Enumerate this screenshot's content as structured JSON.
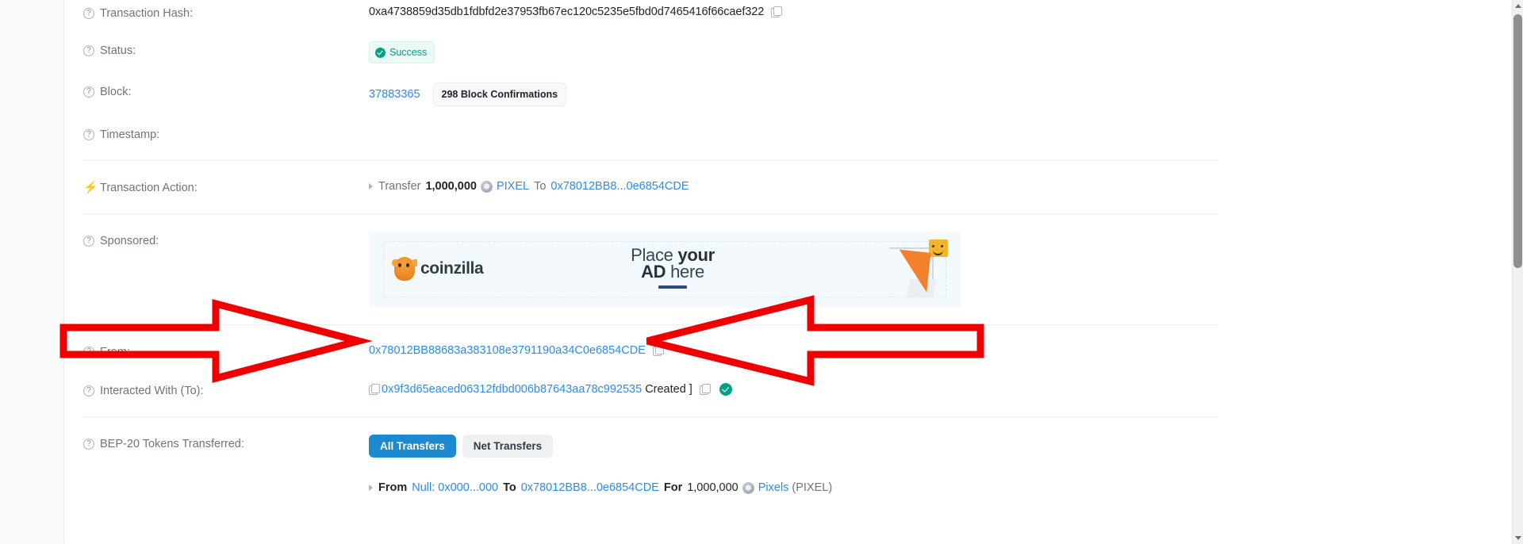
{
  "rows": {
    "tx_hash": {
      "label": "Transaction Hash:",
      "value": "0xa4738859d35db1fdbfd2e37953fb67ec120c5235e5fbd0d7465416f66caef322"
    },
    "status": {
      "label": "Status:",
      "value": "Success"
    },
    "block": {
      "label": "Block:",
      "number": "37883365",
      "confirmations": "298 Block Confirmations"
    },
    "timestamp": {
      "label": "Timestamp:",
      "value": ""
    },
    "action": {
      "label": "Transaction Action:",
      "verb": "Transfer",
      "amount": "1,000,000",
      "token": "PIXEL",
      "to_word": "To",
      "to_addr": "0x78012BB8...0e6854CDE"
    },
    "sponsored": {
      "label": "Sponsored:",
      "brand": "coinzilla",
      "line1_a": "Place ",
      "line1_b": "your",
      "line2_a": "AD",
      "line2_b": " here"
    },
    "from": {
      "label": "From:",
      "value": "0x78012BB88683a383108e3791190a34C0e6854CDE"
    },
    "interacted": {
      "label": "Interacted With (To):",
      "address": "0x9f3d65eaced06312fdbd006b87643aa78c992535",
      "created_tag": "Created ]"
    },
    "bep20": {
      "label": "BEP-20 Tokens Transferred:",
      "tab_all": "All Transfers",
      "tab_net": "Net Transfers",
      "transfer": {
        "from_word": "From",
        "from_addr": "Null: 0x000...000",
        "to_word": "To",
        "to_addr": "0x78012BB8...0e6854CDE",
        "for_word": "For",
        "amount": "1,000,000",
        "token_name": "Pixels",
        "token_symbol": "(PIXEL)"
      }
    }
  },
  "icons": {
    "question": "?",
    "bolt": "⚡",
    "copy": "copy-icon"
  },
  "colors": {
    "link": "#2d8be8",
    "success": "#00a186",
    "tab_active": "#1c8ad1",
    "annotation": "#ee0000"
  }
}
